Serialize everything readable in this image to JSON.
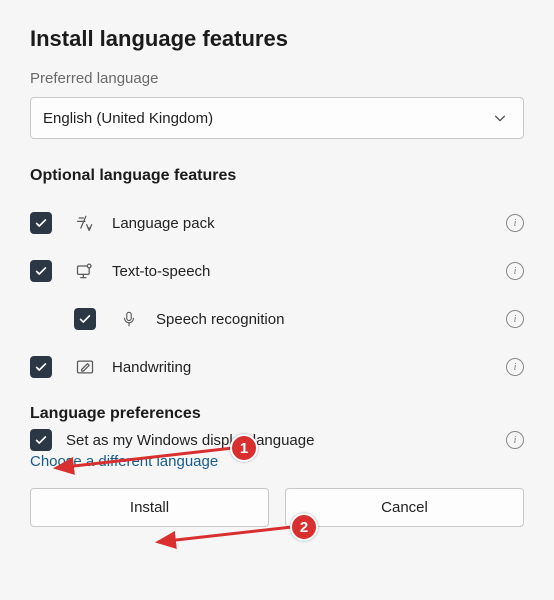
{
  "title": "Install language features",
  "preferred_label": "Preferred language",
  "dropdown": {
    "value": "English (United Kingdom)"
  },
  "optional_title": "Optional language features",
  "features": {
    "language_pack": "Language pack",
    "tts": "Text-to-speech",
    "speech": "Speech recognition",
    "handwriting": "Handwriting"
  },
  "prefs_title": "Language preferences",
  "prefs": {
    "display_lang": "Set as my Windows display language",
    "choose_diff": "Choose a different language"
  },
  "buttons": {
    "install": "Install",
    "cancel": "Cancel"
  },
  "annotations": {
    "one": "1",
    "two": "2"
  }
}
